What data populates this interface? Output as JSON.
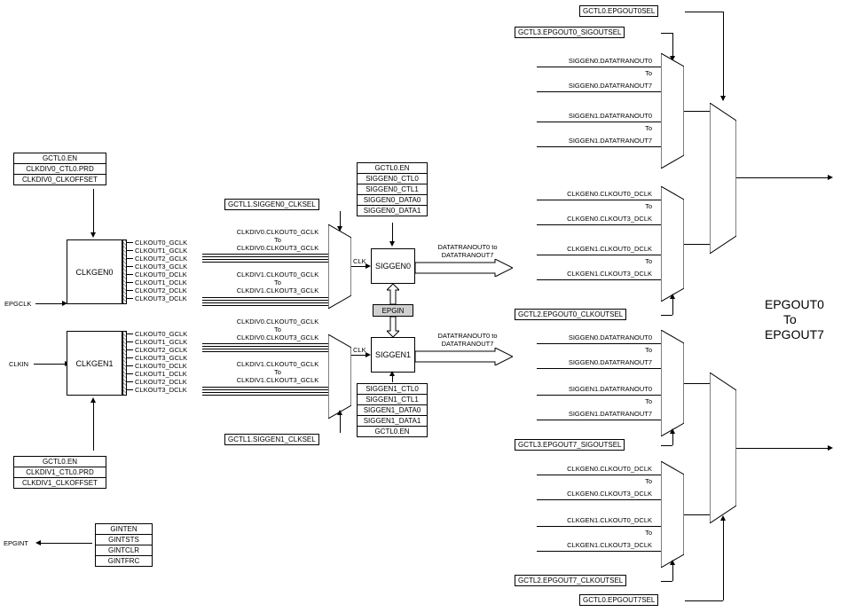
{
  "inputs": {
    "epgclk": "EPGCLK",
    "clkin": "CLKIN",
    "epgint": "EPGINT"
  },
  "outputs": {
    "epgout_header": "EPGOUT0",
    "epgout_mid": "To",
    "epgout_footer": "EPGOUT7"
  },
  "clkdiv0_regs": [
    "GCTL0.EN",
    "CLKDIV0_CTL0.PRD",
    "CLKDIV0_CLKOFFSET"
  ],
  "clkdiv1_regs": [
    "GCTL0.EN",
    "CLKDIV1_CTL0.PRD",
    "CLKDIV1_CLKOFFSET"
  ],
  "gint_regs": [
    "GINTEN",
    "GINTSTS",
    "GINTCLR",
    "GINTFRC"
  ],
  "siggen0_regs": [
    "GCTL0.EN",
    "SIGGEN0_CTL0",
    "SIGGEN0_CTL1",
    "SIGGEN0_DATA0",
    "SIGGEN0_DATA1"
  ],
  "siggen1_regs": [
    "SIGGEN1_CTL0",
    "SIGGEN1_CTL1",
    "SIGGEN1_DATA0",
    "SIGGEN1_DATA1",
    "GCTL0.EN"
  ],
  "blocks": {
    "clkgen0": "CLKGEN0",
    "clkgen1": "CLKGEN1",
    "siggen0": "SIGGEN0",
    "siggen1": "SIGGEN1",
    "epgin": "EPGIN",
    "clk": "CLK"
  },
  "clkgen_outputs": [
    "CLKOUT0_GCLK",
    "CLKOUT1_GCLK",
    "CLKOUT2_GCLK",
    "CLKOUT3_GCLK",
    "CLKOUT0_DCLK",
    "CLKOUT1_DCLK",
    "CLKOUT2_DCLK",
    "CLKOUT3_DCLK"
  ],
  "mux_clksel0": "GCTL1.SIGGEN0_CLKSEL",
  "mux_clksel1": "GCTL1.SIGGEN1_CLKSEL",
  "mux0_inputs": [
    "CLKDIV0.CLKOUT0_GCLK",
    "To",
    "CLKDIV0.CLKOUT3_GCLK",
    "CLKDIV1.CLKOUT0_GCLK",
    "To",
    "CLKDIV1.CLKOUT3_GCLK"
  ],
  "mux1_inputs": [
    "CLKDIV0.CLKOUT0_GCLK",
    "To",
    "CLKDIV0.CLKOUT3_GCLK",
    "CLKDIV1.CLKOUT0_GCLK",
    "To",
    "CLKDIV1.CLKOUT3_GCLK"
  ],
  "siggen_out": {
    "line1": "DATATRANOUT0 to",
    "line2": "DATATRANOUT7"
  },
  "outmux_top_sel": "GCTL0.EPGOUT0SEL",
  "outmux_top_sigsel": "GCTL3.EPGOUT0_SIGOUTSEL",
  "outmux_top_clksel": "GCTL2.EPGOUT0_CLKOUTSEL",
  "outmux_bot_sigsel": "GCTL3.EPGOUT7_SIGOUTSEL",
  "outmux_bot_clksel": "GCTL2.EPGOUT7_CLKOUTSEL",
  "outmux_bot_sel": "GCTL0.EPGOUT7SEL",
  "sigmux_inputs": [
    "SIGGEN0.DATATRANOUT0",
    "To",
    "SIGGEN0.DATATRANOUT7",
    "SIGGEN1.DATATRANOUT0",
    "To",
    "SIGGEN1.DATATRANOUT7"
  ],
  "clkmux_inputs": [
    "CLKGEN0.CLKOUT0_DCLK",
    "To",
    "CLKGEN0.CLKOUT3_DCLK",
    "CLKGEN1.CLKOUT0_DCLK",
    "To",
    "CLKGEN1.CLKOUT3_DCLK"
  ]
}
